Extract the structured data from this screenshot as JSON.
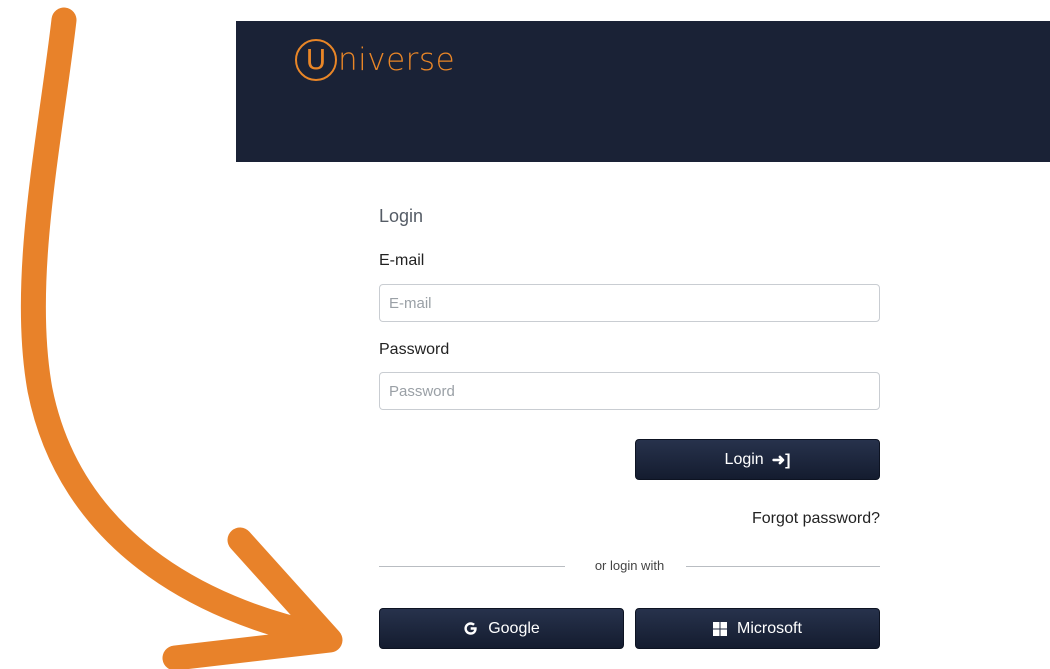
{
  "header": {
    "logo_letter": "U",
    "logo_text": "niverse",
    "bg_color": "#1a2236",
    "accent_color": "#e98627"
  },
  "form": {
    "title": "Login",
    "email": {
      "label": "E-mail",
      "placeholder": "E-mail",
      "value": ""
    },
    "password": {
      "label": "Password",
      "placeholder": "Password",
      "value": ""
    },
    "login_button": {
      "label": "Login",
      "icon": "sign-in-icon"
    },
    "forgot_link": "Forgot password?",
    "divider_text": "or login with",
    "google_button": {
      "label": "Google",
      "icon": "google-g-icon"
    },
    "microsoft_button": {
      "label": "Microsoft",
      "icon": "windows-logo-icon"
    }
  },
  "annotation": {
    "arrow_color": "#e8822a",
    "icon": "curved-arrow-annotation"
  }
}
